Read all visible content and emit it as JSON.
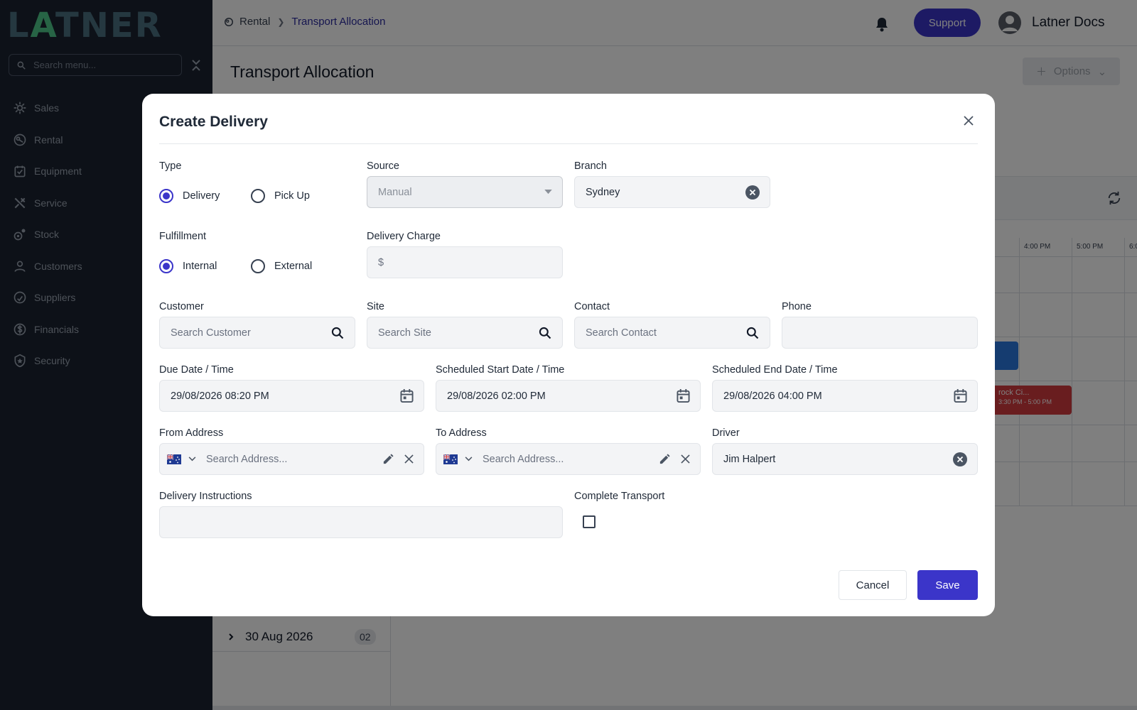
{
  "app": {
    "logo": "LATNER"
  },
  "sidebar": {
    "search_placeholder": "Search menu...",
    "items": [
      {
        "label": "Sales",
        "icon": "sales-icon"
      },
      {
        "label": "Rental",
        "icon": "rental-icon"
      },
      {
        "label": "Equipment",
        "icon": "equipment-icon"
      },
      {
        "label": "Service",
        "icon": "service-icon"
      },
      {
        "label": "Stock",
        "icon": "stock-icon"
      },
      {
        "label": "Customers",
        "icon": "customers-icon"
      },
      {
        "label": "Suppliers",
        "icon": "suppliers-icon"
      },
      {
        "label": "Financials",
        "icon": "financials-icon"
      },
      {
        "label": "Security",
        "icon": "security-icon"
      }
    ]
  },
  "header": {
    "breadcrumb": [
      "Rental",
      "Transport Allocation"
    ],
    "support_label": "Support",
    "user_name": "Latner Docs"
  },
  "page": {
    "title": "Transport Allocation",
    "options_label": "Options",
    "timeline_hours": [
      "",
      "4:00 PM",
      "5:00 PM",
      "6:0"
    ],
    "event": {
      "title": "rock Ci...",
      "time": "3:30 PM - 5:00 PM"
    },
    "date_group": {
      "label": "30 Aug 2026",
      "count": "02"
    }
  },
  "modal": {
    "title": "Create Delivery",
    "type": {
      "label": "Type",
      "options": [
        "Delivery",
        "Pick Up"
      ],
      "selected": "Delivery"
    },
    "source": {
      "label": "Source",
      "value": "Manual"
    },
    "branch": {
      "label": "Branch",
      "value": "Sydney"
    },
    "fulfillment": {
      "label": "Fulfillment",
      "options": [
        "Internal",
        "External"
      ],
      "selected": "Internal"
    },
    "delivery_charge": {
      "label": "Delivery Charge",
      "prefix": "$",
      "value": ""
    },
    "customer": {
      "label": "Customer",
      "placeholder": "Search Customer"
    },
    "site": {
      "label": "Site",
      "placeholder": "Search Site"
    },
    "contact": {
      "label": "Contact",
      "placeholder": "Search Contact"
    },
    "phone": {
      "label": "Phone",
      "value": ""
    },
    "due": {
      "label": "Due Date / Time",
      "value": "29/08/2026 08:20 PM"
    },
    "sched_start": {
      "label": "Scheduled Start Date / Time",
      "value": "29/08/2026 02:00 PM"
    },
    "sched_end": {
      "label": "Scheduled End Date / Time",
      "value": "29/08/2026 04:00 PM"
    },
    "from_address": {
      "label": "From Address",
      "placeholder": "Search Address..."
    },
    "to_address": {
      "label": "To Address",
      "placeholder": "Search Address..."
    },
    "driver": {
      "label": "Driver",
      "value": "Jim Halpert"
    },
    "instructions": {
      "label": "Delivery Instructions",
      "value": ""
    },
    "complete": {
      "label": "Complete Transport",
      "checked": false
    },
    "cancel_label": "Cancel",
    "save_label": "Save"
  },
  "colors": {
    "primary": "#3b35c9",
    "sidebar_bg": "#1b2330",
    "event_red": "#d33a3f",
    "event_blue": "#2a78e0",
    "brand_green": "#4ec98a"
  }
}
